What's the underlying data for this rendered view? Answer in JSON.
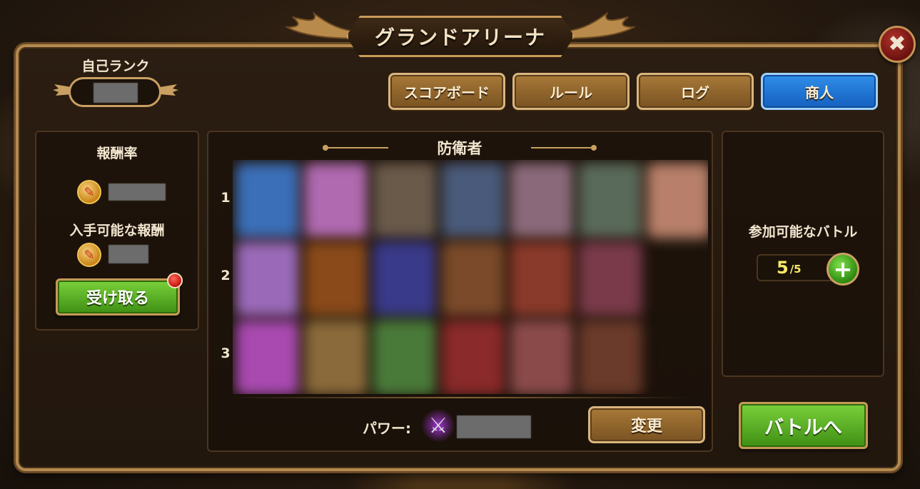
{
  "window": {
    "title": "グランドアリーナ",
    "close_icon": "close-icon"
  },
  "rank": {
    "label": "自己ランク"
  },
  "tabs": [
    {
      "label": "スコアボード",
      "active": false
    },
    {
      "label": "ルール",
      "active": false
    },
    {
      "label": "ログ",
      "active": false
    },
    {
      "label": "商人",
      "active": true
    }
  ],
  "rewards": {
    "title": "報酬率",
    "available_label": "入手可能な報酬",
    "claim_button": "受け取る",
    "coin_icon": "arena-coin-icon"
  },
  "defenders": {
    "title": "防衛者",
    "rows": [
      "1",
      "2",
      "3"
    ],
    "power_label": "パワー:",
    "change_button": "変更"
  },
  "battles": {
    "title": "参加可能なバトル",
    "current": "5",
    "max": "/5",
    "add_icon": "plus-icon",
    "go_button": "バトルへ"
  },
  "colors": {
    "accent_active_tab": "#1f74d4",
    "green_button": "#5bb227",
    "gold_border": "#c9a062"
  }
}
